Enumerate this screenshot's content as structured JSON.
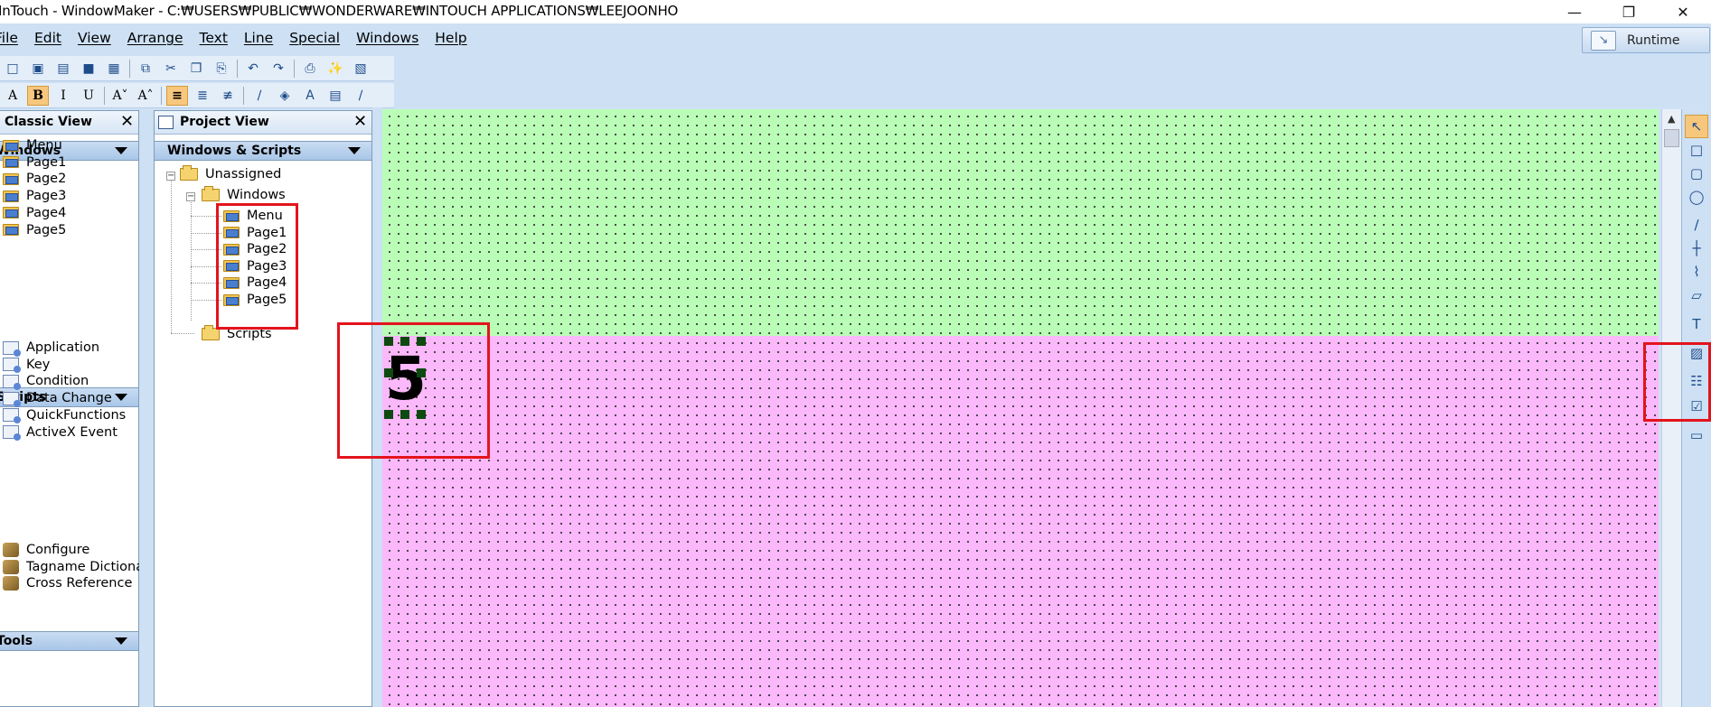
{
  "window": {
    "title": "InTouch - WindowMaker - C:₩USERS₩PUBLIC₩WONDERWARE₩INTOUCH APPLICATIONS₩LEEJOONHO",
    "minimize": "—",
    "restore": "❐",
    "close": "✕"
  },
  "menubar": [
    "File",
    "Edit",
    "View",
    "Arrange",
    "Text",
    "Line",
    "Special",
    "Windows",
    "Help"
  ],
  "runtime": {
    "label": "Runtime",
    "icon": "↘"
  },
  "toolbar1": [
    {
      "name": "new-icon",
      "glyph": "□"
    },
    {
      "name": "open-window-icon",
      "glyph": "▣"
    },
    {
      "name": "close-window-icon",
      "glyph": "▤"
    },
    {
      "name": "save-icon",
      "glyph": "■"
    },
    {
      "name": "save-all-icon",
      "glyph": "▦"
    },
    {
      "name": "sep"
    },
    {
      "name": "duplicate-icon",
      "glyph": "⧉"
    },
    {
      "name": "cut-icon",
      "glyph": "✂"
    },
    {
      "name": "copy-icon",
      "glyph": "❐"
    },
    {
      "name": "paste-icon",
      "glyph": "⎘"
    },
    {
      "name": "sep"
    },
    {
      "name": "undo-icon",
      "glyph": "↶"
    },
    {
      "name": "redo-icon",
      "glyph": "↷"
    },
    {
      "name": "sep"
    },
    {
      "name": "print-icon",
      "glyph": "⎙"
    },
    {
      "name": "wizard-icon",
      "glyph": "✨"
    },
    {
      "name": "window-properties-icon",
      "glyph": "▧"
    }
  ],
  "toolbar2": [
    {
      "name": "font-icon",
      "glyph": "A"
    },
    {
      "name": "bold-icon",
      "glyph": "B",
      "active": true
    },
    {
      "name": "italic-icon",
      "glyph": "I"
    },
    {
      "name": "underline-icon",
      "glyph": "U"
    },
    {
      "name": "sep"
    },
    {
      "name": "reduce-font-icon",
      "glyph": "A˅"
    },
    {
      "name": "enlarge-font-icon",
      "glyph": "A˄"
    },
    {
      "name": "sep"
    },
    {
      "name": "align-left-icon",
      "glyph": "≡",
      "active": true
    },
    {
      "name": "align-center-icon",
      "glyph": "≣"
    },
    {
      "name": "align-right-icon",
      "glyph": "≢"
    },
    {
      "name": "sep"
    },
    {
      "name": "line-color-icon",
      "glyph": "∕"
    },
    {
      "name": "fill-color-icon",
      "glyph": "◈"
    },
    {
      "name": "text-color-icon",
      "glyph": "A"
    },
    {
      "name": "window-color-icon",
      "glyph": "▤"
    },
    {
      "name": "line-style-icon",
      "glyph": "∕"
    }
  ],
  "classic_view": {
    "title": "Classic View",
    "close": "✕",
    "windows_header": "Windows",
    "windows": [
      "Menu",
      "Page1",
      "Page2",
      "Page3",
      "Page4",
      "Page5"
    ],
    "scripts_header": "Scripts",
    "scripts": [
      "Application",
      "Key",
      "Condition",
      "Data Change",
      "QuickFunctions",
      "ActiveX Event"
    ],
    "tools_header": "Tools",
    "tools": [
      "Configure",
      "Tagname Dictiona",
      "Cross Reference"
    ]
  },
  "project_view": {
    "title": "Project View",
    "close": "✕",
    "header": "Windows & Scripts",
    "root": "Unassigned",
    "windows_folder": "Windows",
    "windows": [
      "Menu",
      "Page1",
      "Page2",
      "Page3",
      "Page4",
      "Page5"
    ],
    "scripts_folder": "Scripts"
  },
  "canvas": {
    "page_number": "5",
    "top_color": "#b9fdb7",
    "bottom_color": "#fbb8fa"
  },
  "draw_tools": [
    {
      "name": "select-icon",
      "glyph": "↖",
      "active": true
    },
    {
      "name": "rectangle-icon",
      "glyph": "□"
    },
    {
      "name": "rounded-rectangle-icon",
      "glyph": "▢"
    },
    {
      "name": "ellipse-icon",
      "glyph": "◯"
    },
    {
      "name": "line-icon",
      "glyph": "∕"
    },
    {
      "name": "hv-line-icon",
      "glyph": "┼"
    },
    {
      "name": "polyline-icon",
      "glyph": "⌇"
    },
    {
      "name": "polygon-icon",
      "glyph": "▱"
    },
    {
      "name": "text-icon",
      "glyph": "T"
    },
    {
      "name": "bitmap-icon",
      "glyph": "▨"
    },
    {
      "name": "trend-icon",
      "glyph": "☷"
    },
    {
      "name": "button-wizard-icon",
      "glyph": "☑"
    },
    {
      "name": "button-icon",
      "glyph": "▭"
    }
  ]
}
